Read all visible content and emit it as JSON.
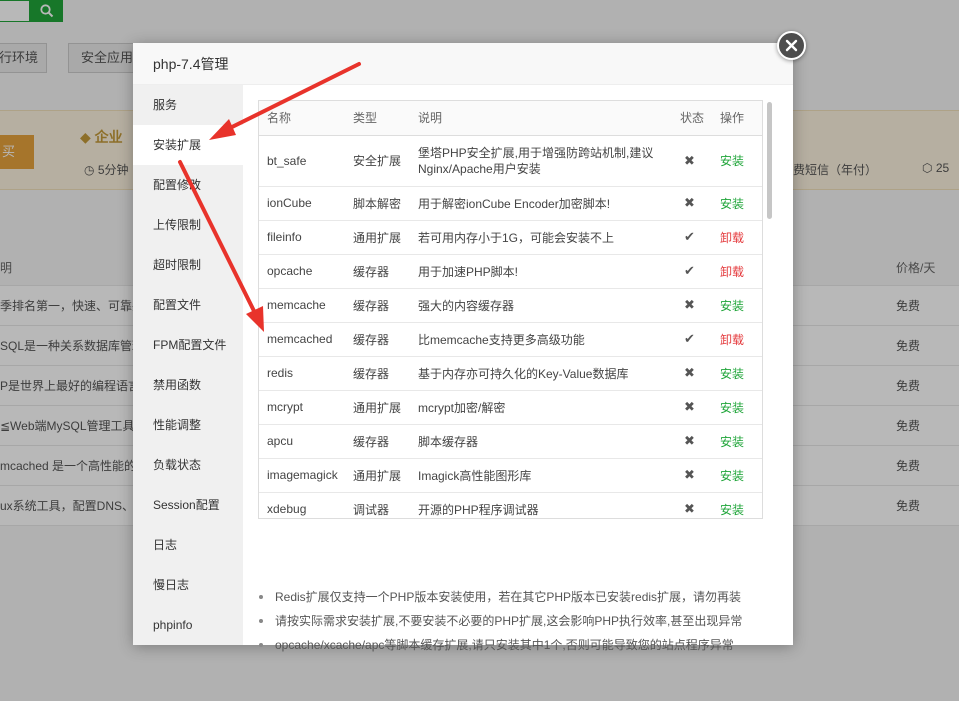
{
  "background": {
    "tabs": [
      "行环境",
      "安全应用"
    ],
    "banner": {
      "buy_label": "买",
      "enterprise_label": "企业",
      "five_min_label": "5分钟",
      "sms_label": "费短信（年付）",
      "ssl_label": "25"
    },
    "table": {
      "header": {
        "desc": "明",
        "price": "价格/天"
      },
      "rows": [
        {
          "desc": "季排名第一，快速、可靠并",
          "price": "免费"
        },
        {
          "desc": "SQL是一种关系数据库管理",
          "price": "免费"
        },
        {
          "desc": "P是世界上最好的编程语言",
          "price": "免费"
        },
        {
          "desc": "≦Web端MySQL管理工具",
          "price": "免费"
        },
        {
          "desc": "mcached 是一个高性能的",
          "price": "免费"
        },
        {
          "desc": "ux系统工具，配置DNS、S",
          "price": "免费"
        }
      ]
    }
  },
  "modal": {
    "title": "php-7.4管理",
    "sidebar": [
      {
        "label": "服务"
      },
      {
        "label": "安装扩展"
      },
      {
        "label": "配置修改"
      },
      {
        "label": "上传限制"
      },
      {
        "label": "超时限制"
      },
      {
        "label": "配置文件"
      },
      {
        "label": "FPM配置文件"
      },
      {
        "label": "禁用函数"
      },
      {
        "label": "性能调整"
      },
      {
        "label": "负载状态"
      },
      {
        "label": "Session配置"
      },
      {
        "label": "日志"
      },
      {
        "label": "慢日志"
      },
      {
        "label": "phpinfo"
      }
    ],
    "active_sidebar": "安装扩展",
    "table": {
      "headers": {
        "name": "名称",
        "type": "类型",
        "desc": "说明",
        "status": "状态",
        "op": "操作"
      },
      "rows": [
        {
          "name": "bt_safe",
          "type": "安全扩展",
          "desc": "堡塔PHP安全扩展,用于增强防跨站机制,建议Nginx/Apache用户安装",
          "status_icon": "✖",
          "installed": false,
          "op": "安装"
        },
        {
          "name": "ionCube",
          "type": "脚本解密",
          "desc": "用于解密ionCube Encoder加密脚本!",
          "status_icon": "✖",
          "installed": false,
          "op": "安装"
        },
        {
          "name": "fileinfo",
          "type": "通用扩展",
          "desc": "若可用内存小于1G，可能会安装不上",
          "status_icon": "✔",
          "installed": true,
          "op": "卸载"
        },
        {
          "name": "opcache",
          "type": "缓存器",
          "desc": "用于加速PHP脚本!",
          "status_icon": "✔",
          "installed": true,
          "op": "卸载"
        },
        {
          "name": "memcache",
          "type": "缓存器",
          "desc": "强大的内容缓存器",
          "status_icon": "✖",
          "installed": false,
          "op": "安装"
        },
        {
          "name": "memcached",
          "type": "缓存器",
          "desc": "比memcache支持更多高级功能",
          "status_icon": "✔",
          "installed": true,
          "op": "卸载"
        },
        {
          "name": "redis",
          "type": "缓存器",
          "desc": "基于内存亦可持久化的Key-Value数据库",
          "status_icon": "✖",
          "installed": false,
          "op": "安装"
        },
        {
          "name": "mcrypt",
          "type": "通用扩展",
          "desc": "mcrypt加密/解密",
          "status_icon": "✖",
          "installed": false,
          "op": "安装"
        },
        {
          "name": "apcu",
          "type": "缓存器",
          "desc": "脚本缓存器",
          "status_icon": "✖",
          "installed": false,
          "op": "安装"
        },
        {
          "name": "imagemagick",
          "type": "通用扩展",
          "desc": "Imagick高性能图形库",
          "status_icon": "✖",
          "installed": false,
          "op": "安装"
        },
        {
          "name": "xdebug",
          "type": "调试器",
          "desc": "开源的PHP程序调试器",
          "status_icon": "✖",
          "installed": false,
          "op": "安装"
        }
      ]
    },
    "tips": [
      "Redis扩展仅支持一个PHP版本安装使用，若在其它PHP版本已安装redis扩展，请勿再装",
      "请按实际需求安装扩展,不要安装不必要的PHP扩展,这会影响PHP执行效率,甚至出现异常",
      "opcache/xcache/apc等脚本缓存扩展,请只安装其中1个,否则可能导致您的站点程序异常"
    ]
  },
  "colors": {
    "install": "#20a53a",
    "uninstall": "#e4393c",
    "annotation_arrow": "#e8332b"
  }
}
